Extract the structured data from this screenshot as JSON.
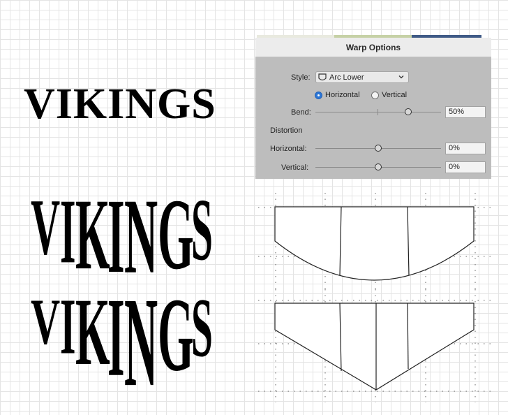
{
  "dialog": {
    "title": "Warp Options",
    "style_label": "Style:",
    "style_value": "Arc Lower",
    "orientation": {
      "horizontal_label": "Horizontal",
      "vertical_label": "Vertical",
      "selected": "Horizontal"
    },
    "bend": {
      "label": "Bend:",
      "value": "50%",
      "level": 50
    },
    "distortion": {
      "heading": "Distortion",
      "horizontal": {
        "label": "Horizontal:",
        "value": "0%",
        "level": 0
      },
      "vertical": {
        "label": "Vertical:",
        "value": "0%",
        "level": 0
      }
    }
  },
  "artwork": {
    "original_word": "VIKINGS",
    "warped_arc_word": "VIKINGS",
    "warped_point_word": "VIKINGS"
  },
  "colors": {
    "radio_accent": "#2b76d6",
    "dialog_bg": "#bdbdbd"
  }
}
